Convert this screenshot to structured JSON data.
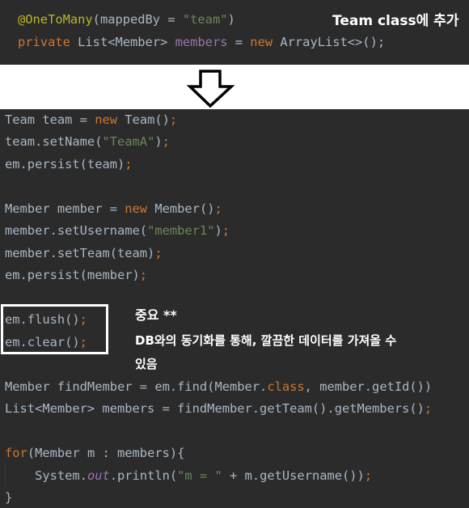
{
  "top_code": {
    "line1": {
      "annotation": "@OneToMany",
      "open": "(mappedBy = ",
      "str": "\"team\"",
      "close": ")"
    },
    "line2": {
      "kw1": "private",
      "t1": " List<Member> ",
      "field": "members",
      "t2": " = ",
      "kw2": "new",
      "t3": " ArrayList<>();"
    }
  },
  "notes": {
    "top_note": "Team class에 추가",
    "important_title": "중요 **",
    "important_line1": "DB와의 동기화를 통해, 깔끔한 데이터를 가져올 수",
    "important_line2": "있음"
  },
  "bottom_code": {
    "l1": {
      "a": "Team team = ",
      "kw": "new",
      "b": " Team()",
      "semi": ";"
    },
    "l2": {
      "a": "team.setName(",
      "str": "\"TeamA\"",
      "b": ")",
      "semi": ";"
    },
    "l3": {
      "a": "em.persist(team)",
      "semi": ";"
    },
    "l4": {
      "a": "Member member = ",
      "kw": "new",
      "b": " Member()",
      "semi": ";"
    },
    "l5": {
      "a": "member.setUsername(",
      "str": "\"member1\"",
      "b": ")",
      "semi": ";"
    },
    "l6": {
      "a": "member.setTeam(team)",
      "semi": ";"
    },
    "l7": {
      "a": "em.persist(member)",
      "semi": ";"
    },
    "l8": {
      "a": "em.flush()",
      "semi": ";"
    },
    "l9": {
      "a": "em.clear()",
      "semi": ";"
    },
    "l10": {
      "a": "Member findMember = em.find(Member.",
      "kw": "class",
      "b": ", member.getId())"
    },
    "l11": {
      "a": "List<Member> members = findMember.getTeam().getMembers()",
      "semi": ";"
    },
    "l12": {
      "kw": "for",
      "a": "(Member m : members){"
    },
    "l13": {
      "indent": "    System.",
      "field": "out",
      "a": ".println(",
      "str": "\"m = \"",
      "b": " + m.getUsername())",
      "semi": ";"
    },
    "l14": {
      "a": "}"
    }
  },
  "colors": {
    "editor_bg": "#2b2b2b",
    "text": "#a9b7c6",
    "keyword": "#cc7832",
    "string": "#6a8759",
    "annotation": "#bbb529",
    "field": "#9876aa"
  },
  "icons": {
    "arrow": "down-arrow-icon"
  }
}
